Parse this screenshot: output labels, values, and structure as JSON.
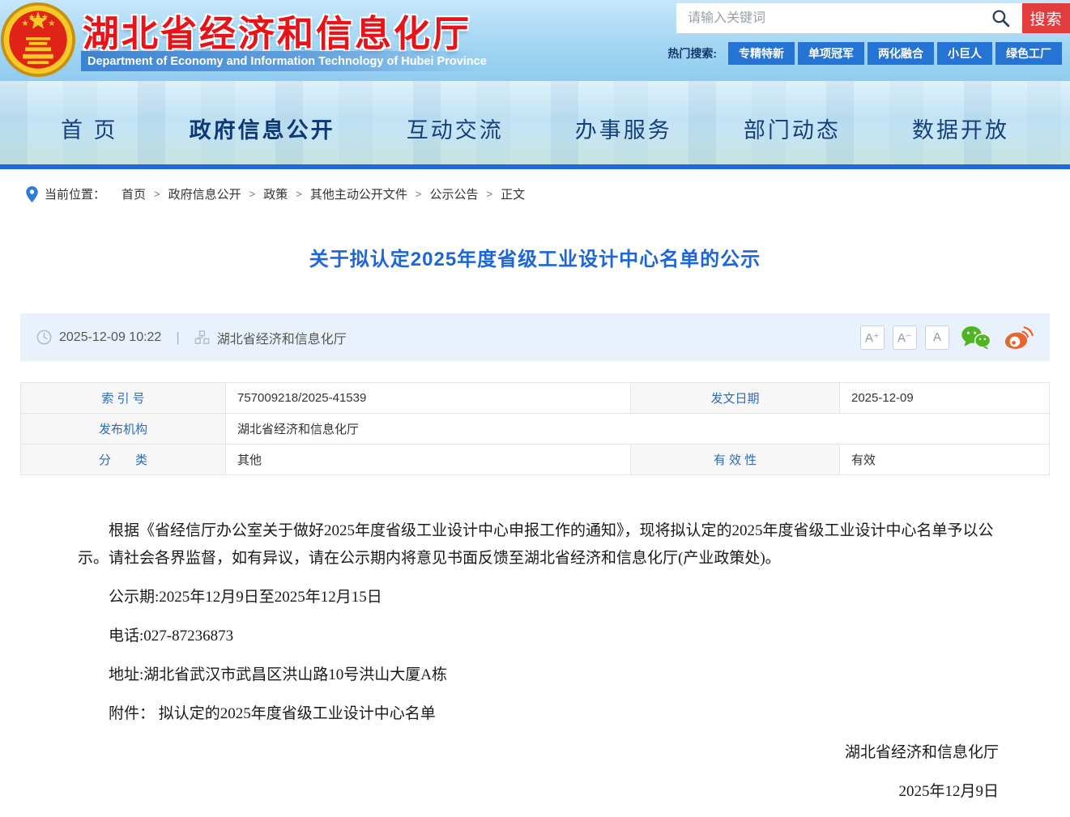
{
  "colors": {
    "header_accent_red": "#e81318",
    "nav_blue_bar": "#2368d9",
    "search_button_red": "#e23c3f",
    "hot_tag_blue": "#2573d3",
    "title_link_blue": "#1c66d9",
    "table_label_blue": "#2e6cb4",
    "meta_bar_bg": "#e9f2fc",
    "wechat_green": "#4db520",
    "weibo_orange": "#e6662e"
  },
  "header": {
    "site_title": "湖北省经济和信息化厅",
    "site_subtitle": "Department of Economy and Information Technology of Hubei Province",
    "search": {
      "placeholder": "请输入关键词",
      "button_label": "搜索",
      "hot_label": "热门搜索:",
      "hot_tags": [
        "专精特新",
        "单项冠军",
        "两化融合",
        "小巨人",
        "绿色工厂"
      ]
    }
  },
  "nav": {
    "items": [
      "首 页",
      "政府信息公开",
      "互动交流",
      "办事服务",
      "部门动态",
      "数据开放"
    ],
    "active_index": 1
  },
  "breadcrumb": {
    "label": "当前位置：",
    "separator": ">",
    "items": [
      "首页",
      "政府信息公开",
      "政策",
      "其他主动公开文件",
      "公示公告",
      "正文"
    ]
  },
  "article": {
    "title": "关于拟认定2025年度省级工业设计中心名单的公示",
    "meta": {
      "datetime": "2025-12-09 10:22",
      "divider": "|",
      "source": "湖北省经济和信息化厅",
      "font_larger": "A⁺",
      "font_smaller": "A⁻",
      "font_normal": "A"
    },
    "info_table": {
      "index_label": "索 引 号",
      "index_value": "757009218/2025-41539",
      "date_label": "发文日期",
      "date_value": "2025-12-09",
      "org_label": "发布机构",
      "org_value": "湖北省经济和信息化厅",
      "category_label": "分　　类",
      "category_value": "其他",
      "validity_label": "有 效 性",
      "validity_value": "有效"
    },
    "paragraphs": [
      "根据《省经信厅办公室关于做好2025年度省级工业设计中心申报工作的通知》，现将拟认定的2025年度省级工业设计中心名单予以公示。请社会各界监督，如有异议，请在公示期内将意见书面反馈至湖北省经济和信息化厅(产业政策处)。",
      "公示期:2025年12月9日至2025年12月15日",
      "电话:027-87236873",
      "地址:湖北省武汉市武昌区洪山路10号洪山大厦A栋",
      "附件： 拟认定的2025年度省级工业设计中心名单"
    ],
    "signature": {
      "org": "湖北省经济和信息化厅",
      "date": "2025年12月9日"
    }
  },
  "icons": {
    "logo": "national-emblem",
    "search": "magnifier-icon",
    "breadcrumb": "location-pin-icon",
    "time": "clock-icon",
    "source": "sitemap-icon",
    "share": [
      "wechat-icon",
      "weibo-icon"
    ]
  }
}
